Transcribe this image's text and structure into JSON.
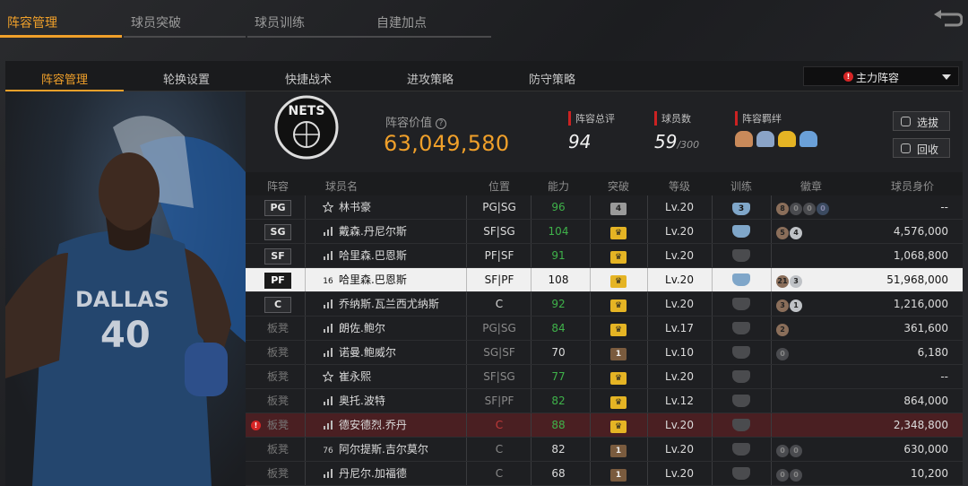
{
  "top_tabs": [
    "阵容管理",
    "球员突破",
    "球员训练",
    "自建加点"
  ],
  "sub_tabs": [
    "阵容管理",
    "轮换设置",
    "快捷战术",
    "进攻策略",
    "防守策略"
  ],
  "lineup_select": "主力阵容",
  "summary": {
    "value_label": "阵容价值",
    "value": "63,049,580",
    "rating_label": "阵容总评",
    "rating": "94",
    "count_label": "球员数",
    "count": "59",
    "count_max": "/300",
    "bond_label": "阵容羁绊",
    "btn_decompose": "选拔",
    "btn_recycle": "回收"
  },
  "table": {
    "headers": [
      "阵容",
      "球员名",
      "位置",
      "能力",
      "突破",
      "等级",
      "训练",
      "徽章",
      "球员身价"
    ],
    "rows": [
      {
        "slot": "PG",
        "bench": false,
        "name": "林书豪",
        "pos": "PG|SG",
        "ovr": "96",
        "break": "4",
        "level": "Lv.20",
        "train": "3",
        "price": "--"
      },
      {
        "slot": "SG",
        "bench": false,
        "name": "戴森.丹尼尔斯",
        "pos": "SF|SG",
        "ovr": "104",
        "break": "crown",
        "level": "Lv.20",
        "train": "on",
        "price": "4,576,000"
      },
      {
        "slot": "SF",
        "bench": false,
        "name": "哈里森.巴恩斯",
        "pos": "PF|SF",
        "ovr": "91",
        "break": "crown",
        "level": "Lv.20",
        "train": "off",
        "price": "1,068,800"
      },
      {
        "slot": "PF",
        "bench": false,
        "name": "哈里森.巴恩斯",
        "pos": "SF|PF",
        "ovr": "108",
        "break": "crown",
        "level": "Lv.20",
        "train": "on",
        "price": "51,968,000"
      },
      {
        "slot": "C",
        "bench": false,
        "name": "乔纳斯.瓦兰西尤纳斯",
        "pos": "C",
        "ovr": "92",
        "break": "crown",
        "level": "Lv.20",
        "train": "off",
        "price": "1,216,000"
      },
      {
        "slot": "板凳",
        "bench": true,
        "name": "朗佐.鲍尔",
        "pos": "PG|SG",
        "ovr": "84",
        "break": "crown",
        "level": "Lv.17",
        "train": "off",
        "price": "361,600"
      },
      {
        "slot": "板凳",
        "bench": true,
        "name": "诺曼.鲍威尔",
        "pos": "SG|SF",
        "ovr": "70",
        "break": "1",
        "level": "Lv.10",
        "train": "off",
        "price": "6,180"
      },
      {
        "slot": "板凳",
        "bench": true,
        "name": "崔永熙",
        "pos": "SF|SG",
        "ovr": "77",
        "break": "crown",
        "level": "Lv.20",
        "train": "off",
        "price": "--"
      },
      {
        "slot": "板凳",
        "bench": true,
        "name": "奥托.波特",
        "pos": "SF|PF",
        "ovr": "82",
        "break": "crown",
        "level": "Lv.12",
        "train": "off",
        "price": "864,000"
      },
      {
        "slot": "板凳",
        "bench": true,
        "name": "德安德烈.乔丹",
        "pos": "C",
        "ovr": "88",
        "break": "crown",
        "level": "Lv.20",
        "train": "off",
        "price": "2,348,800"
      },
      {
        "slot": "板凳",
        "bench": true,
        "name": "阿尔提斯.吉尔莫尔",
        "pos": "C",
        "ovr": "82",
        "break": "1",
        "level": "Lv.20",
        "train": "off",
        "price": "630,000"
      },
      {
        "slot": "板凳",
        "bench": true,
        "name": "丹尼尔.加福德",
        "pos": "C",
        "ovr": "68",
        "break": "1",
        "level": "Lv.20",
        "train": "off",
        "price": "10,200"
      }
    ],
    "row_badges": [
      [
        "8",
        "0",
        "0",
        "0"
      ],
      [
        "5",
        "4"
      ],
      [],
      [
        "21",
        "3"
      ],
      [
        "3",
        "1"
      ],
      [
        "2"
      ],
      [
        "0"
      ],
      [],
      [],
      [],
      [
        "0",
        "0"
      ],
      [
        "0",
        "0"
      ]
    ],
    "row_icon_text": [
      "",
      "",
      "",
      "16",
      "",
      "",
      "",
      "",
      "",
      "",
      "76",
      ""
    ]
  },
  "player_card": {
    "team_text": "DALLAS",
    "jersey_number": "40"
  },
  "team_logo_text": "NETS",
  "colors": {
    "accent": "#f0a02a",
    "green": "#3fb24a",
    "red": "#c23a3a",
    "alert": "#d62525"
  }
}
